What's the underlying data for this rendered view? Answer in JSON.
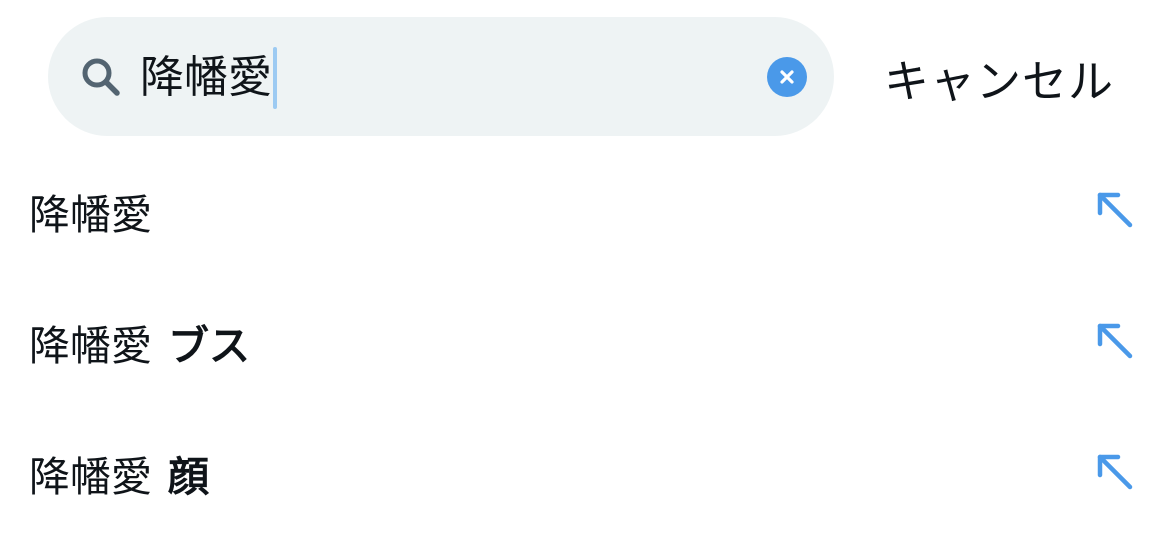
{
  "search": {
    "query": "降幡愛",
    "clear_icon": "clear-x-icon",
    "search_icon": "magnifier-icon"
  },
  "header": {
    "cancel_label": "キャンセル"
  },
  "suggestions": [
    {
      "base": "降幡愛",
      "extra": ""
    },
    {
      "base": "降幡愛",
      "extra": "ブス"
    },
    {
      "base": "降幡愛",
      "extra": "顔"
    }
  ],
  "colors": {
    "accent": "#4a99e9",
    "search_bg": "#eef3f4",
    "caret": "#9ccaf2",
    "text": "#0f1419"
  }
}
